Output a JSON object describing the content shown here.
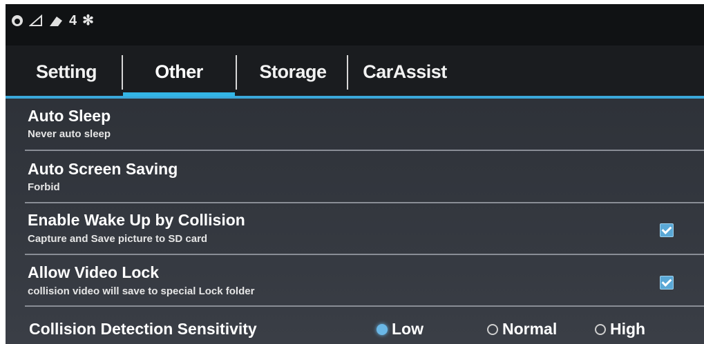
{
  "status_bar": {
    "icons": [
      "app-icon",
      "signal-icon",
      "usb-icon",
      "bluetooth-icon"
    ],
    "badge": "4"
  },
  "tabs": [
    {
      "label": "Setting",
      "active": false
    },
    {
      "label": "Other",
      "active": true
    },
    {
      "label": "Storage",
      "active": false
    },
    {
      "label": "CarAssist",
      "active": false
    }
  ],
  "settings": [
    {
      "title": "Auto Sleep",
      "summary": "Never auto sleep"
    },
    {
      "title": "Auto Screen Saving",
      "summary": "Forbid"
    },
    {
      "title": "Enable Wake Up by Collision",
      "summary": "Capture and Save picture to SD card",
      "checked": true
    },
    {
      "title": "Allow Video Lock",
      "summary": "collision video will save to special Lock folder",
      "checked": true
    }
  ],
  "sensitivity": {
    "title": "Collision Detection Sensitivity",
    "options": [
      "Low",
      "Normal",
      "High"
    ],
    "selected": "Low"
  },
  "colors": {
    "accent": "#33b5e5"
  }
}
